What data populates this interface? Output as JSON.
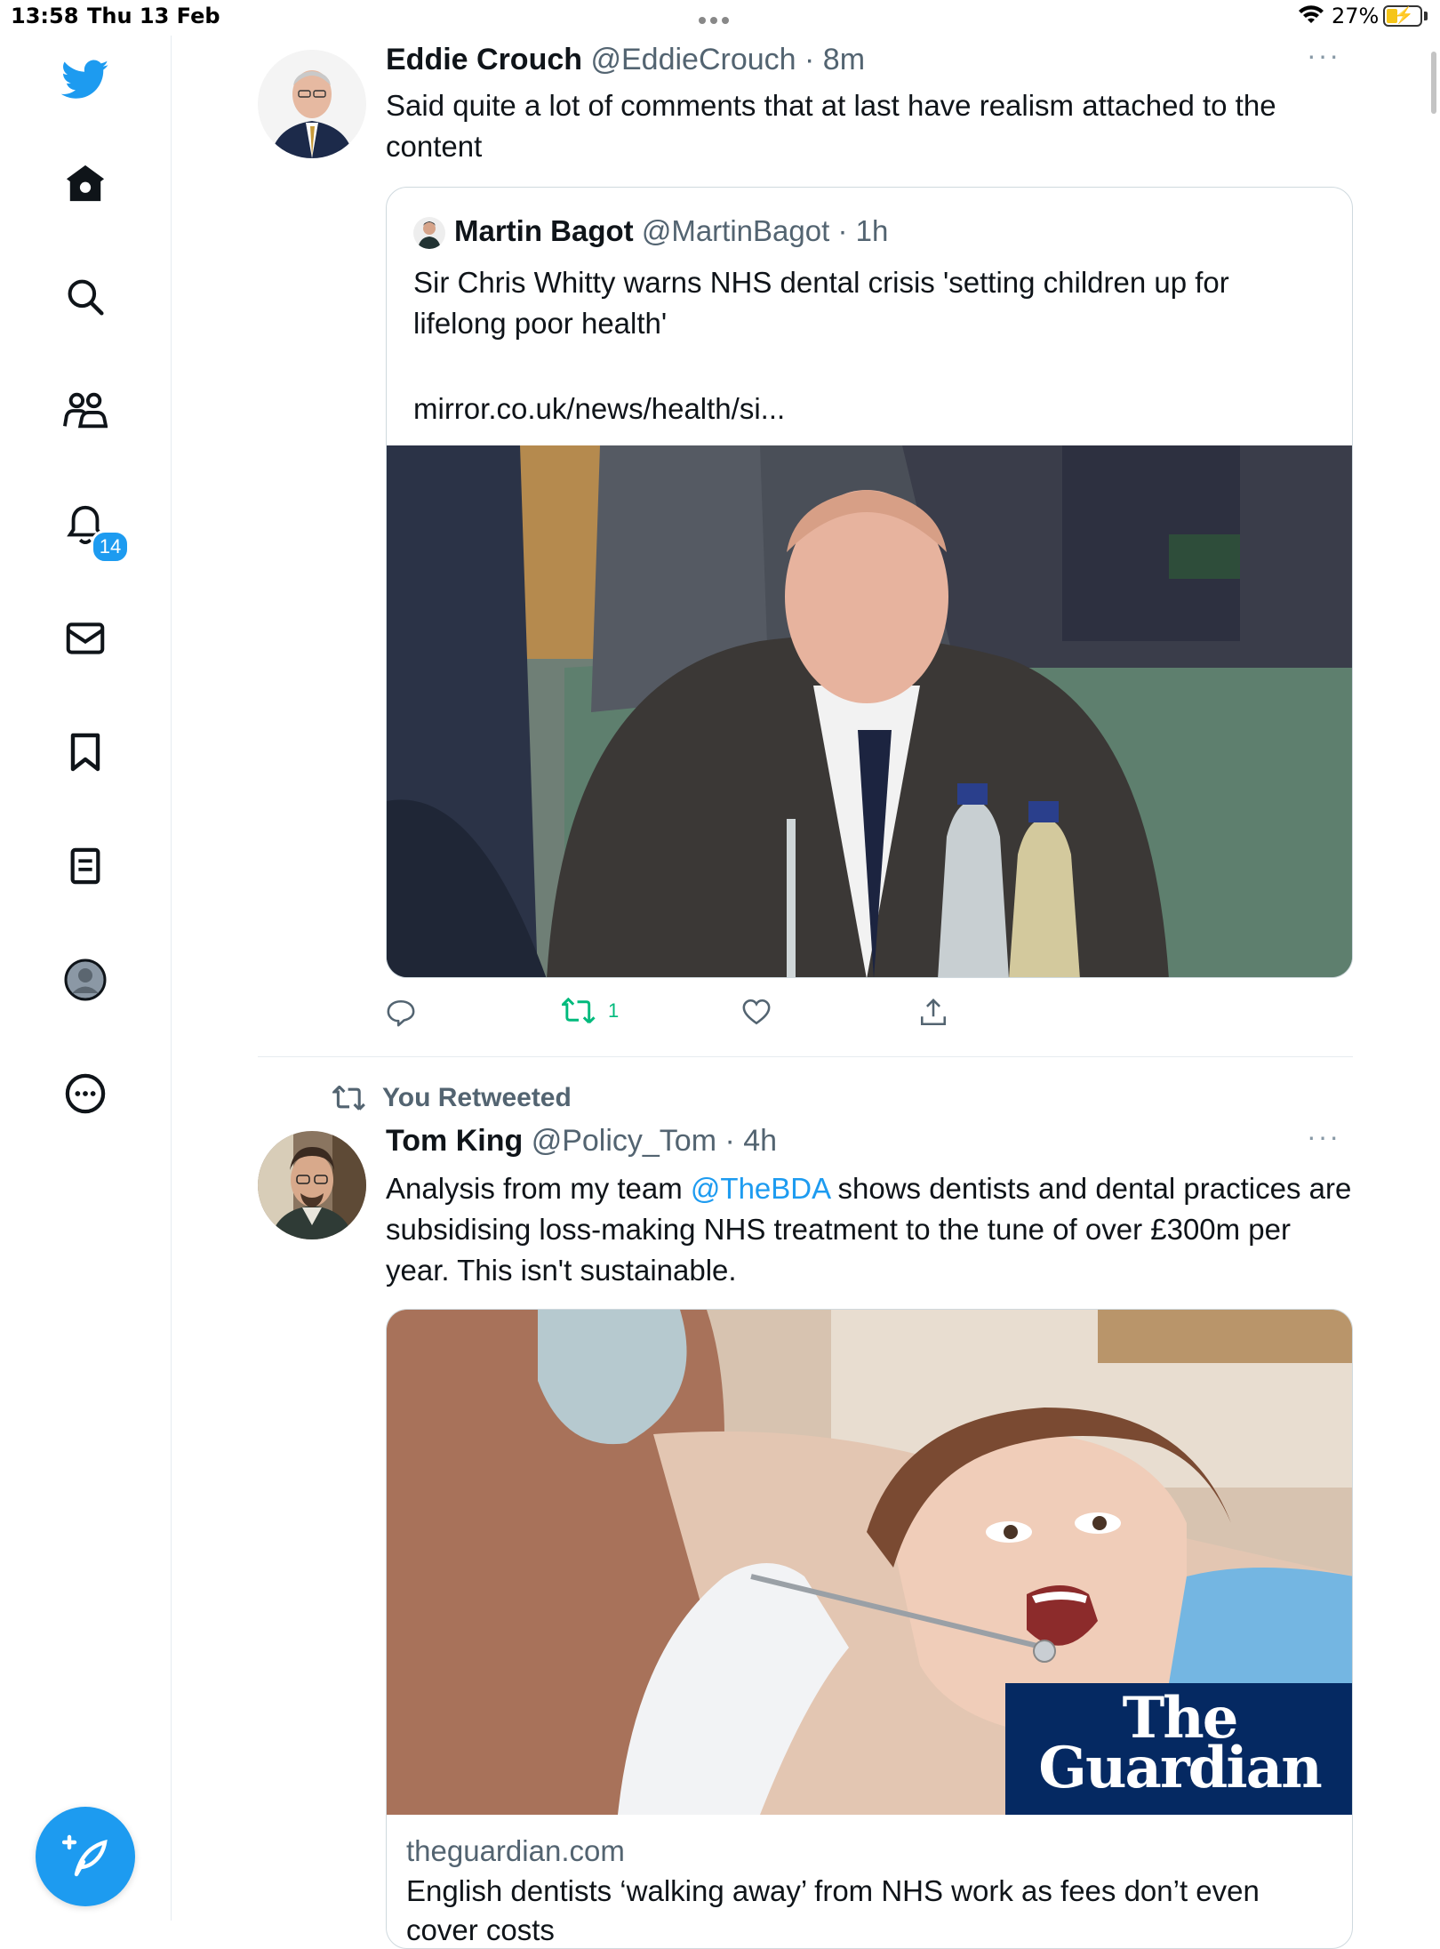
{
  "status_bar": {
    "time": "13:58",
    "date": "Thu 13 Feb",
    "battery": "27%"
  },
  "sidebar": {
    "items": [
      {
        "icon": "twitter-bird-icon"
      },
      {
        "icon": "home-icon"
      },
      {
        "icon": "search-icon"
      },
      {
        "icon": "communities-icon"
      },
      {
        "icon": "notifications-bell-icon",
        "badge": "14"
      },
      {
        "icon": "messages-envelope-icon"
      },
      {
        "icon": "bookmark-icon"
      },
      {
        "icon": "lists-icon"
      },
      {
        "icon": "profile-avatar-icon"
      },
      {
        "icon": "more-circle-icon"
      }
    ],
    "compose_icon": "compose-tweet-icon"
  },
  "colors": {
    "accent": "#1d9bf0",
    "retweet_active": "#00ba7c",
    "secondary_text": "#536471",
    "guardian_blue": "#052962"
  },
  "tweet1": {
    "name": "Eddie Crouch",
    "handle": "@EddieCrouch",
    "time": "· 8m",
    "text": "Said quite a lot of comments that at last have realism attached to the content",
    "quote": {
      "name": "Martin Bagot",
      "handle": "@MartinBagot",
      "time": "· 1h",
      "text": "Sir Chris Whitty warns NHS dental crisis 'setting children up for lifelong poor health'",
      "link": "mirror.co.uk/news/health/si..."
    },
    "actions": {
      "retweet_count": "1"
    }
  },
  "tweet2": {
    "retweet_label": "You Retweeted",
    "name": "Tom King",
    "handle": "@Policy_Tom",
    "time": "· 4h",
    "text_before": "Analysis from my team ",
    "mention": "@TheBDA",
    "text_after": " shows dentists and dental practices are subsidising loss-making NHS treatment to the tune of over £300m per year. This isn't sustainable.",
    "card": {
      "logo_line1": "The",
      "logo_line2": "Guardian",
      "domain": "theguardian.com",
      "title": "English dentists ‘walking away’ from NHS work as fees don’t even cover costs"
    }
  }
}
